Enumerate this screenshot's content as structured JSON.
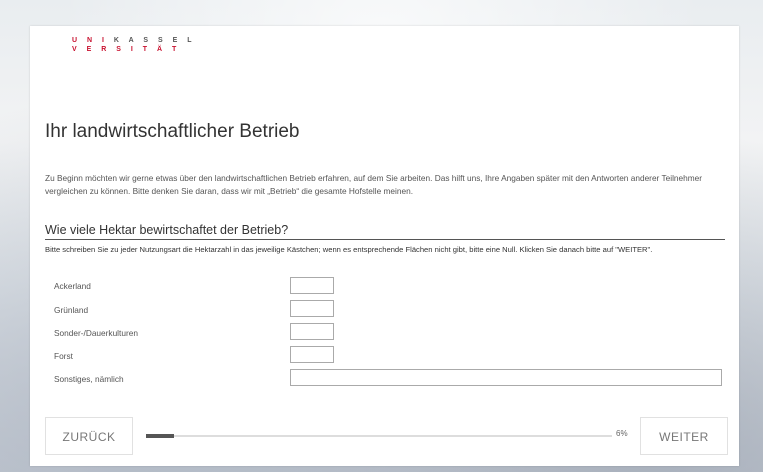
{
  "logo": {
    "line1_a": "U N I",
    "line1_b": "K A S S E L",
    "line2": "V E R S I T Ä T"
  },
  "page": {
    "title": "Ihr landwirtschaftlicher Betrieb",
    "intro": "Zu Beginn möchten wir gerne etwas über den landwirtschaftlichen Betrieb erfahren, auf dem Sie arbeiten. Das hilft uns, Ihre Angaben später mit den Antworten anderer Teilnehmer vergleichen zu können. Bitte denken Sie daran, dass wir mit „Betrieb“ die gesamte Hofstelle meinen."
  },
  "question": {
    "title": "Wie viele Hektar bewirtschaftet der Betrieb?",
    "instruction": "Bitte schreiben Sie zu jeder Nutzungsart die Hektarzahl in das jeweilige Kästchen; wenn es entsprechende Flächen nicht gibt, bitte eine Null. Klicken Sie danach bitte auf \"WEITER\".",
    "rows": [
      {
        "label": "Ackerland",
        "value": ""
      },
      {
        "label": "Grünland",
        "value": ""
      },
      {
        "label": "Sonder-/Dauerkulturen",
        "value": ""
      },
      {
        "label": "Forst",
        "value": ""
      },
      {
        "label": "Sonstiges, nämlich",
        "value": ""
      }
    ]
  },
  "nav": {
    "back_label": "ZURÜCK",
    "next_label": "WEITER",
    "progress_text": "6%",
    "progress_fraction": 0.06
  }
}
